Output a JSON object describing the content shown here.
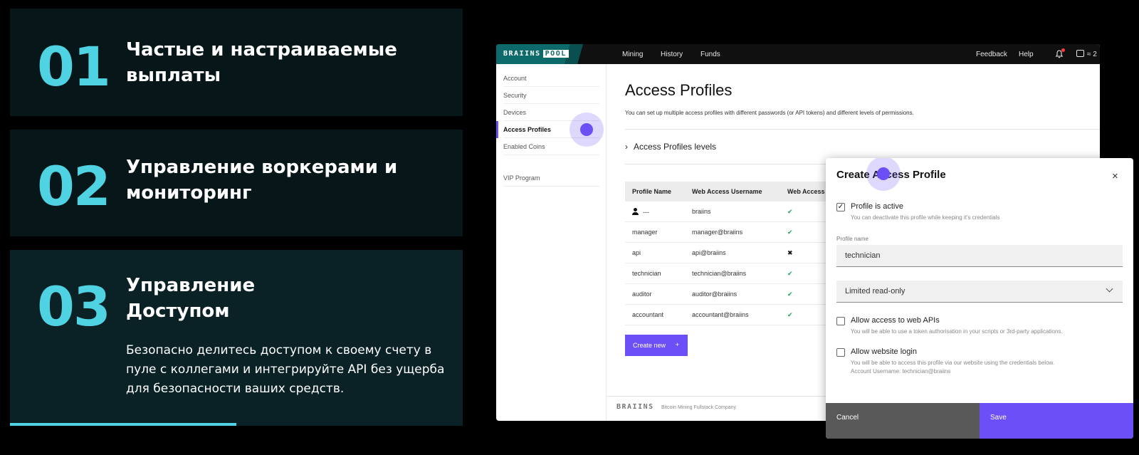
{
  "features": [
    {
      "number": "01",
      "title_line1": "Частые и настраиваемые",
      "title_line2": "выплаты"
    },
    {
      "number": "02",
      "title_line1": "Управление воркерами и",
      "title_line2": "мониторинг"
    },
    {
      "number": "03",
      "title_line1": "Управление",
      "title_line2": "Доступом",
      "description": "Безопасно делитесь доступом к своему счету в пуле с коллегами и интегрируйте API без ущерба для безопасности ваших средств."
    }
  ],
  "progress_fraction": 0.5,
  "app": {
    "logo": {
      "brand": "BRAIINS",
      "product": "POOL"
    },
    "nav": [
      "Mining",
      "History",
      "Funds"
    ],
    "top_right": {
      "feedback": "Feedback",
      "help": "Help",
      "wallet_value": "≈ 2"
    },
    "icons": {
      "bell": "bell-icon",
      "wallet": "wallet-icon"
    },
    "sidebar": [
      "Account",
      "Security",
      "Devices",
      "Access Profiles",
      "Enabled Coins",
      "VIP Program"
    ],
    "active_sidebar": "Access Profiles",
    "page_title": "Access Profiles",
    "page_desc": "You can set up multiple access profiles with different passwords (or API tokens) and different levels of permissions.",
    "levels_label": "Access Profiles levels",
    "table": {
      "headers": [
        "Profile Name",
        "Web Access Username",
        "Web Access"
      ],
      "rows": [
        {
          "name": "---",
          "username": "braiins",
          "web": "✔"
        },
        {
          "name": "manager",
          "username": "manager@braiins",
          "web": "✔"
        },
        {
          "name": "api",
          "username": "api@braiins",
          "web": "✖"
        },
        {
          "name": "technician",
          "username": "technician@braiins",
          "web": "✔"
        },
        {
          "name": "auditor",
          "username": "auditor@braiins",
          "web": "✔"
        },
        {
          "name": "accountant",
          "username": "accountant@braiins",
          "web": "✔"
        }
      ]
    },
    "create_button": "Create new",
    "create_plus": "+",
    "footer": {
      "logo": "BRAIINS",
      "text": "Bitcoin Mining Fullstack Company"
    }
  },
  "modal": {
    "title": "Create Access Profile",
    "close": "×",
    "active_label": "Profile is active",
    "active_hint": "You can deactivate this profile while keeping it's credentials",
    "active_checked": "✓",
    "profile_name_label": "Profile name",
    "profile_name_value": "technician",
    "permission_value": "Limited read-only",
    "web_api_label": "Allow access to web APIs",
    "web_api_hint": "You will be able to use a token authorisation in your scripts or 3rd-party applications.",
    "website_label": "Allow website login",
    "website_hint": "You will be able to access this profile via our website using the credentials below.",
    "account_username": "Account Username: technician@braiins",
    "cancel": "Cancel",
    "save": "Save"
  },
  "colors": {
    "accent": "#4fd3e2",
    "primary": "#6c4ff6",
    "success": "#1aa55a"
  }
}
